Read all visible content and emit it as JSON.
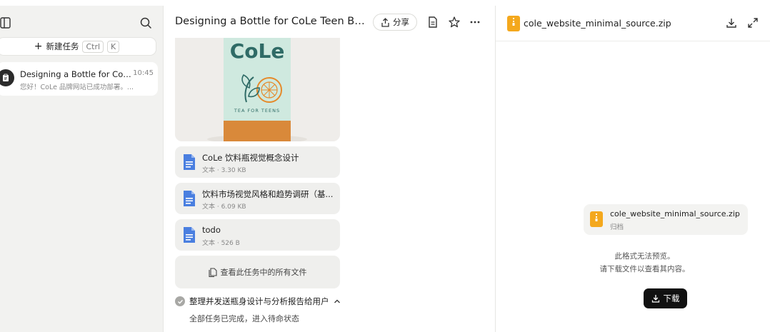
{
  "sidebar": {
    "new_task_label": "新建任务",
    "shortcut_ctrl": "Ctrl",
    "shortcut_k": "K",
    "task": {
      "title": "Designing a Bottle for CoLe T...",
      "time": "10:45",
      "preview": "您好！CoLe 品牌网站已成功部署。..."
    }
  },
  "chat": {
    "title": "Designing a Bottle for CoLe Teen Beve...",
    "share_label": "分享",
    "hero": {
      "brand": "CoLe",
      "tagline": "TEA FOR TEENS"
    },
    "files": [
      {
        "name": "CoLe 饮料瓶视觉概念设计",
        "meta": "文本 · 3.30 KB"
      },
      {
        "name": "饮料市场视觉风格和趋势调研（基...",
        "meta": "文本 · 6.09 KB"
      },
      {
        "name": "todo",
        "meta": "文本 · 526 B"
      }
    ],
    "view_all_label": "查看此任务中的所有文件",
    "step_title": "整理并发送瓶身设计与分析报告给用户",
    "step_status": "全部任务已完成，进入待命状态"
  },
  "preview": {
    "filename": "cole_website_minimal_source.zip",
    "archive_name": "cole_website_minimal_source.zip",
    "archive_type": "归档",
    "msg_line1": "此格式无法预览。",
    "msg_line2": "请下载文件以查看其内容。",
    "download_label": "下载"
  },
  "colors": {
    "doc_icon": "#4a7fe0",
    "zip_icon": "#f4a81d",
    "bottle_label": "#cfe9df",
    "bottle_liquid": "#d9893a"
  }
}
